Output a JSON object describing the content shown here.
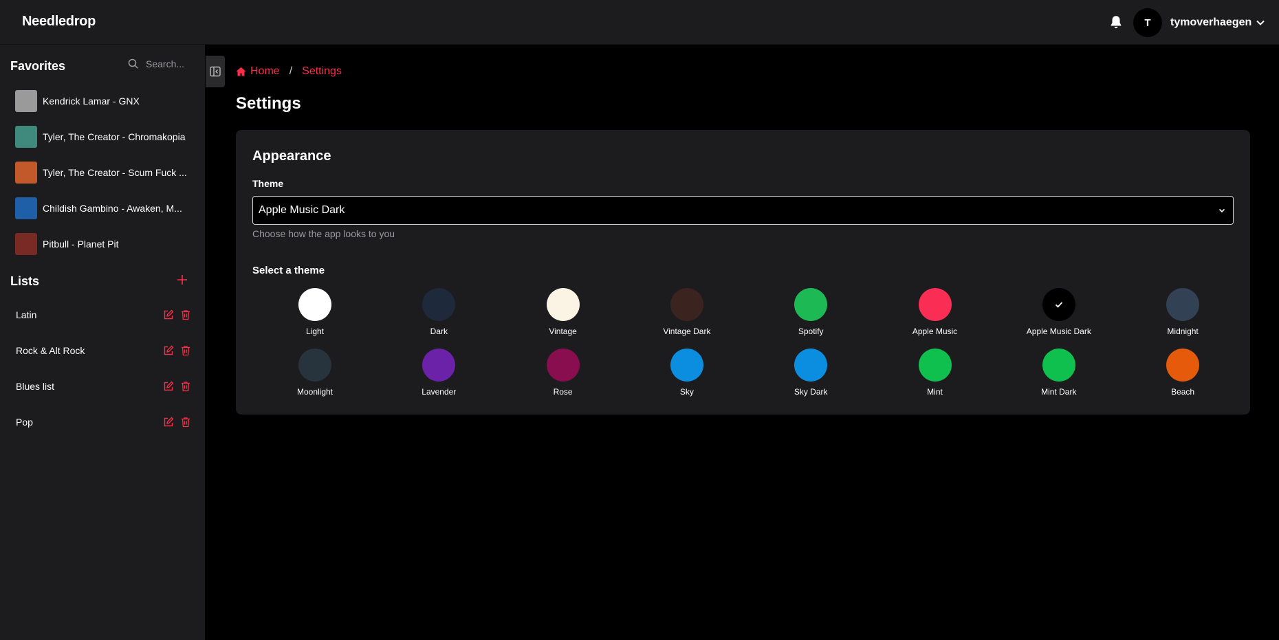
{
  "app": {
    "brand": "Needledrop"
  },
  "header": {
    "avatar_initial": "T",
    "username": "tymoverhaegen"
  },
  "sidebar": {
    "favorites_title": "Favorites",
    "search_placeholder": "Search...",
    "favorites": [
      {
        "label": "Kendrick Lamar - GNX",
        "thumb_color": "#9a9a9a"
      },
      {
        "label": "Tyler, The Creator - Chromakopia",
        "thumb_color": "#3f8a7d"
      },
      {
        "label": "Tyler, The Creator - Scum Fuck ...",
        "thumb_color": "#c2592a"
      },
      {
        "label": "Childish Gambino - Awaken, M...",
        "thumb_color": "#1e5fa8"
      },
      {
        "label": "Pitbull - Planet Pit",
        "thumb_color": "#7a2a24"
      }
    ],
    "lists_title": "Lists",
    "lists": [
      {
        "label": "Latin"
      },
      {
        "label": "Rock & Alt Rock"
      },
      {
        "label": "Blues list"
      },
      {
        "label": "Pop"
      }
    ]
  },
  "breadcrumb": {
    "home": "Home",
    "current": "Settings"
  },
  "page": {
    "title": "Settings"
  },
  "appearance": {
    "title": "Appearance",
    "theme_label": "Theme",
    "theme_value": "Apple Music Dark",
    "helper": "Choose how the app looks to you",
    "select_title": "Select a theme",
    "selected": "Apple Music Dark",
    "themes": [
      {
        "name": "Light",
        "color": "#ffffff"
      },
      {
        "name": "Dark",
        "color": "#1e293b"
      },
      {
        "name": "Vintage",
        "color": "#fbf4e4"
      },
      {
        "name": "Vintage Dark",
        "color": "#3b2420"
      },
      {
        "name": "Spotify",
        "color": "#1db954"
      },
      {
        "name": "Apple Music",
        "color": "#fa2d55"
      },
      {
        "name": "Apple Music Dark",
        "color": "#000000"
      },
      {
        "name": "Midnight",
        "color": "#334155"
      },
      {
        "name": "Moonlight",
        "color": "#27333d"
      },
      {
        "name": "Lavender",
        "color": "#6b21a8"
      },
      {
        "name": "Rose",
        "color": "#880e4f"
      },
      {
        "name": "Sky",
        "color": "#0b8ee0"
      },
      {
        "name": "Sky Dark",
        "color": "#0b8ee0"
      },
      {
        "name": "Mint",
        "color": "#0fc04f"
      },
      {
        "name": "Mint Dark",
        "color": "#0fc04f"
      },
      {
        "name": "Beach",
        "color": "#e65a0c"
      }
    ]
  },
  "colors": {
    "accent": "#fa2d48",
    "surface": "#1c1c1e",
    "background": "#000000"
  }
}
